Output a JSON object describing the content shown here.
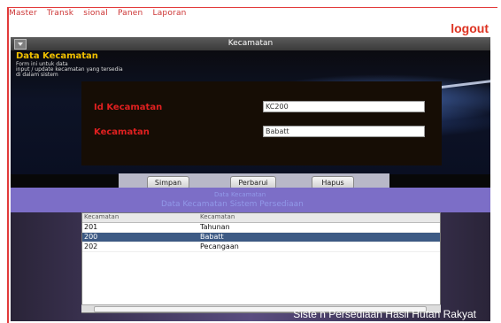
{
  "menu": {
    "items": [
      "Master",
      "Transk",
      "sional",
      "Panen",
      "Laporan"
    ]
  },
  "logout": "logout",
  "window": {
    "title": "Kecamatan"
  },
  "section": {
    "heading": "Data Kecamatan",
    "lines": [
      "Form ini untuk data",
      "input / update kecamatan yang tersedia",
      "di dalam sistem"
    ]
  },
  "form": {
    "id_label": "Id Kecamatan",
    "id_value": "KC200",
    "name_label": "Kecamatan",
    "name_value": "Babatt"
  },
  "buttons": {
    "simpan": "Simpan",
    "perbarui": "Perbarui",
    "hapus": "Hapus"
  },
  "band": {
    "line1": "Data Kecamatan",
    "line2": "Data Kecamatan Sistem Persediaan"
  },
  "table": {
    "headers": [
      "Kecamatan",
      "Kecamatan"
    ],
    "rows": [
      {
        "id": "201",
        "name": "Tahunan",
        "selected": false
      },
      {
        "id": "200",
        "name": "Babatt",
        "selected": true
      },
      {
        "id": "202",
        "name": "Pecangaan",
        "selected": false
      }
    ]
  },
  "footer": "Siste n Persediaan Hasil Hutan Rakyat"
}
